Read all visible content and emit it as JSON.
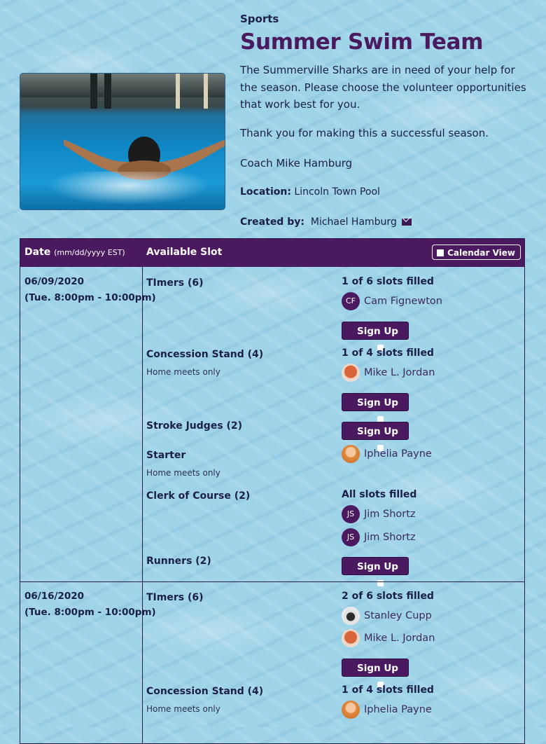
{
  "header": {
    "category": "Sports",
    "title": "Summer Swim Team",
    "description": "The Summerville Sharks are in need of your help for the season. Please choose the volunteer opportunities that work best for you.",
    "thanks": "Thank you for making this a successful season.",
    "signature": "Coach Mike Hamburg",
    "location_label": "Location:",
    "location": "Lincoln Town Pool",
    "created_label": "Created by:",
    "created_by": "Michael Hamburg"
  },
  "table": {
    "date_header": "Date",
    "date_format": "(mm/dd/yyyy EST)",
    "slot_header": "Available Slot",
    "calendar_button": "Calendar View",
    "signup_label": "Sign Up"
  },
  "days": [
    {
      "date": "06/09/2020",
      "time": "(Tue. 8:00pm - 10:00pm)",
      "slots": [
        {
          "name": "TImers (6)",
          "note": "",
          "status": "1 of 6 slots filled",
          "people": [
            {
              "initials": "CF",
              "name": "Cam Fignewton"
            }
          ]
        },
        {
          "name": "Concession Stand (4)",
          "note": "Home meets only",
          "status": "1 of 4 slots filled",
          "people": [
            {
              "initials": "",
              "name": "Mike L. Jordan"
            }
          ]
        },
        {
          "name": "Stroke Judges (2)",
          "note": "",
          "status": "",
          "people": []
        },
        {
          "name": "Starter",
          "note": "Home meets only",
          "status": "",
          "people": [
            {
              "initials": "",
              "name": "Iphelia Payne"
            }
          ]
        },
        {
          "name": "Clerk of Course (2)",
          "note": "",
          "status": "All slots filled",
          "people": [
            {
              "initials": "JS",
              "name": "Jim Shortz"
            },
            {
              "initials": "JS",
              "name": "Jim Shortz"
            }
          ]
        },
        {
          "name": "Runners (2)",
          "note": "",
          "status": "",
          "people": []
        }
      ]
    },
    {
      "date": "06/16/2020",
      "time": "(Tue. 8:00pm - 10:00pm)",
      "slots": [
        {
          "name": "TImers (6)",
          "note": "",
          "status": "2 of 6 slots filled",
          "people": [
            {
              "initials": "",
              "name": "Stanley Cupp"
            },
            {
              "initials": "",
              "name": "Mike L. Jordan"
            }
          ]
        },
        {
          "name": "Concession Stand (4)",
          "note": "Home meets only",
          "status": "1 of 4 slots filled",
          "people": [
            {
              "initials": "",
              "name": "Iphelia Payne"
            }
          ]
        }
      ]
    }
  ]
}
